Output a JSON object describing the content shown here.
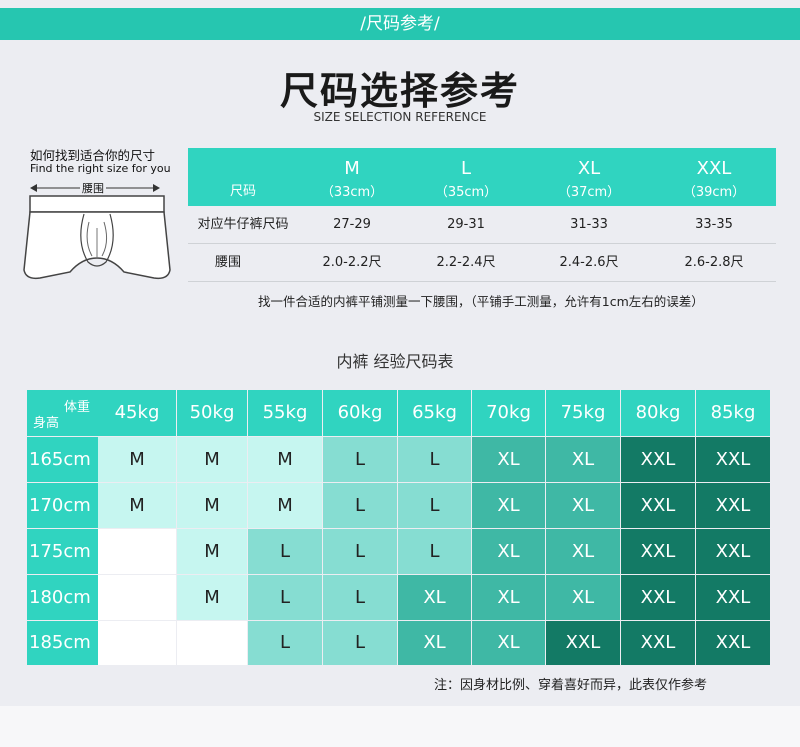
{
  "banner": {
    "text": "/尺码参考/"
  },
  "title": {
    "cn": "尺码选择参考",
    "en": "SIZE SELECTION REFERENCE"
  },
  "guide": {
    "cn": "如何找到适合你的尺寸",
    "en": "Find the right size for you",
    "waist_label": "腰围",
    "icon": "briefs-illustration"
  },
  "size_table": {
    "row_label": "尺码",
    "sizes": [
      {
        "name": "M",
        "cm": "（33cm）"
      },
      {
        "name": "L",
        "cm": "（35cm）"
      },
      {
        "name": "XL",
        "cm": "（37cm）"
      },
      {
        "name": "XXL",
        "cm": "（39cm）"
      }
    ],
    "rows": [
      {
        "label": "对应牛仔裤尺码",
        "values": [
          "27-29",
          "29-31",
          "31-33",
          "33-35"
        ]
      },
      {
        "label": "腰围",
        "values": [
          "2.0-2.2尺",
          "2.2-2.4尺",
          "2.4-2.6尺",
          "2.6-2.8尺"
        ]
      }
    ],
    "note": "找一件合适的内裤平铺测量一下腰围，（平铺手工测量，允许有1cm左右的误差）"
  },
  "experience": {
    "title": "内裤 经验尺码表",
    "corner_weight": "体重",
    "corner_height": "身高",
    "weights": [
      "45kg",
      "50kg",
      "55kg",
      "60kg",
      "65kg",
      "70kg",
      "75kg",
      "80kg",
      "85kg"
    ],
    "rows": [
      {
        "height": "165cm",
        "cells": [
          "M",
          "M",
          "M",
          "L",
          "L",
          "XL",
          "XL",
          "XXL",
          "XXL"
        ]
      },
      {
        "height": "170cm",
        "cells": [
          "M",
          "M",
          "M",
          "L",
          "L",
          "XL",
          "XL",
          "XXL",
          "XXL"
        ]
      },
      {
        "height": "175cm",
        "cells": [
          "",
          "M",
          "L",
          "L",
          "L",
          "XL",
          "XL",
          "XXL",
          "XXL"
        ]
      },
      {
        "height": "180cm",
        "cells": [
          "",
          "M",
          "L",
          "L",
          "XL",
          "XL",
          "XL",
          "XXL",
          "XXL"
        ]
      },
      {
        "height": "185cm",
        "cells": [
          "",
          "",
          "L",
          "L",
          "XL",
          "XL",
          "XXL",
          "XXL",
          "XXL"
        ]
      }
    ],
    "note": "注：因身材比例、穿着喜好而异，此表仅作参考"
  },
  "colors": {
    "accent": "#30d4c0",
    "size_fill": {
      "M": "#c6f6f0",
      "L": "#86ddd2",
      "XL": "#3fb8a5",
      "XXL": "#137a65",
      "empty": "#ffffff"
    }
  }
}
